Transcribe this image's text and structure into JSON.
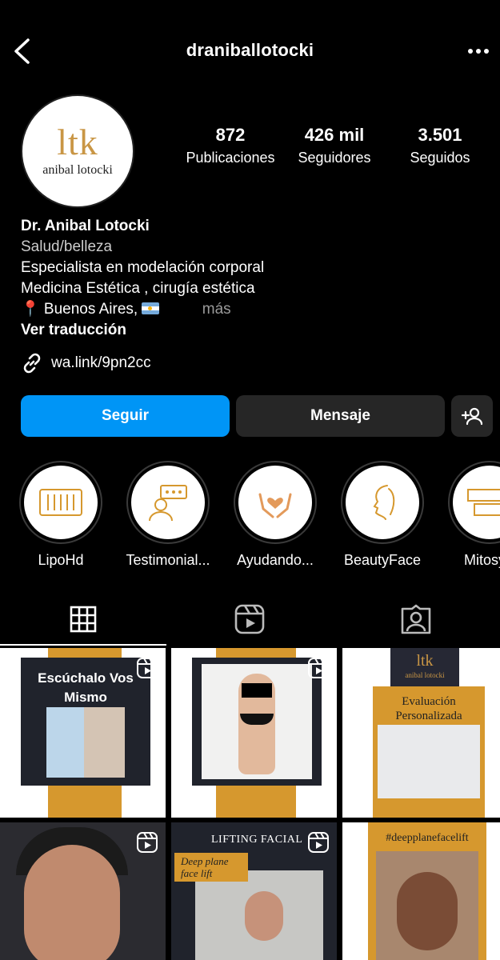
{
  "header": {
    "username": "draniballotocki"
  },
  "avatar": {
    "logo_mark": "ltk",
    "logo_name": "anibal lotocki"
  },
  "stats": {
    "posts": {
      "value": "872",
      "label": "Publicaciones"
    },
    "followers": {
      "value": "426 mil",
      "label": "Seguidores"
    },
    "following": {
      "value": "3.501",
      "label": "Seguidos"
    }
  },
  "bio": {
    "name": "Dr. Anibal Lotocki",
    "category": "Salud/belleza",
    "line1": "Especialista en modelación corporal",
    "line2": "Medicina Estética , cirugía estética",
    "location": "📍 Buenos Aires,",
    "more": "más",
    "translate": "Ver traducción"
  },
  "link": {
    "text": "wa.link/9pn2cc"
  },
  "buttons": {
    "follow": "Seguir",
    "message": "Mensaje"
  },
  "highlights": [
    {
      "label": "LipoHd"
    },
    {
      "label": "Testimonial..."
    },
    {
      "label": "Ayudando..."
    },
    {
      "label": "BeautyFace"
    },
    {
      "label": "MitosyV"
    }
  ],
  "posts": {
    "p1_title": "Escúchalo Vos Mismo",
    "p3_logo": "ltk",
    "p3_logo_name": "anibal lotocki",
    "p3_title": "Evaluación Personalizada",
    "p5_title": "LIFTING FACIAL",
    "p5_tag": "Deep plane face lift",
    "p6_title": "#deepplanefacelift"
  },
  "colors": {
    "accent_blue": "#0095f6",
    "gold": "#d6982e",
    "button_dark": "#262626"
  }
}
